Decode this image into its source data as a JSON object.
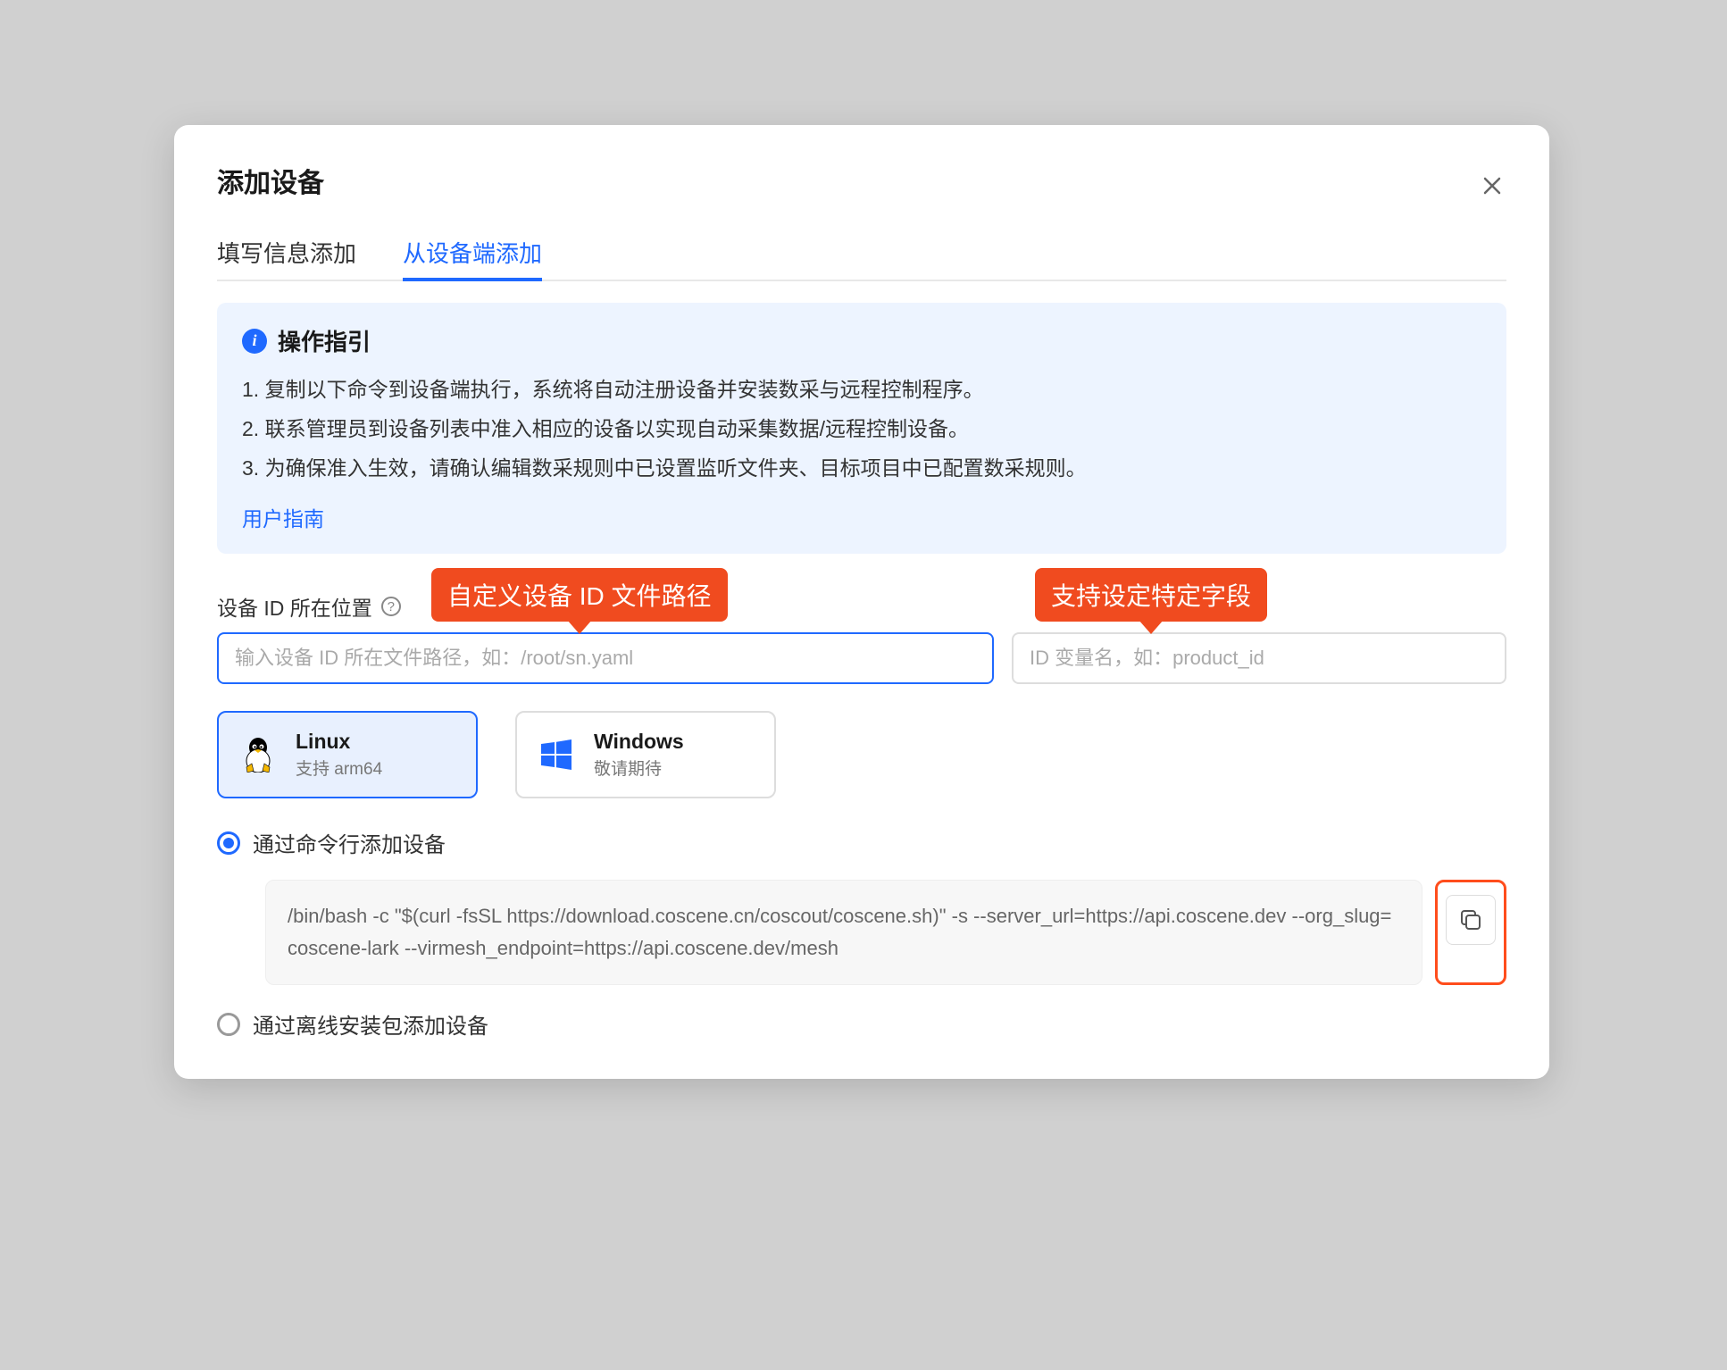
{
  "modal": {
    "title": "添加设备"
  },
  "tabs": {
    "manual": "填写信息添加",
    "device": "从设备端添加"
  },
  "guide": {
    "title": "操作指引",
    "step1": "1. 复制以下命令到设备端执行，系统将自动注册设备并安装数采与远程控制程序。",
    "step2": "2. 联系管理员到设备列表中准入相应的设备以实现自动采集数据/远程控制设备。",
    "step3": "3. 为确保准入生效，请确认编辑数采规则中已设置监听文件夹、目标项目中已配置数采规则。",
    "link": "用户指南"
  },
  "field": {
    "label": "设备 ID 所在位置",
    "path_placeholder": "输入设备 ID 所在文件路径，如：/root/sn.yaml",
    "var_placeholder": "ID 变量名，如：product_id"
  },
  "callouts": {
    "path": "自定义设备 ID 文件路径",
    "var": "支持设定特定字段"
  },
  "os": {
    "linux_name": "Linux",
    "linux_sub": "支持 arm64",
    "windows_name": "Windows",
    "windows_sub": "敬请期待"
  },
  "radios": {
    "cmd": "通过命令行添加设备",
    "offline": "通过离线安装包添加设备"
  },
  "command": "/bin/bash -c \"$(curl -fsSL https://download.coscene.cn/coscout/coscene.sh)\" -s --server_url=https://api.coscene.dev --org_slug=coscene-lark --virmesh_endpoint=https://api.coscene.dev/mesh"
}
